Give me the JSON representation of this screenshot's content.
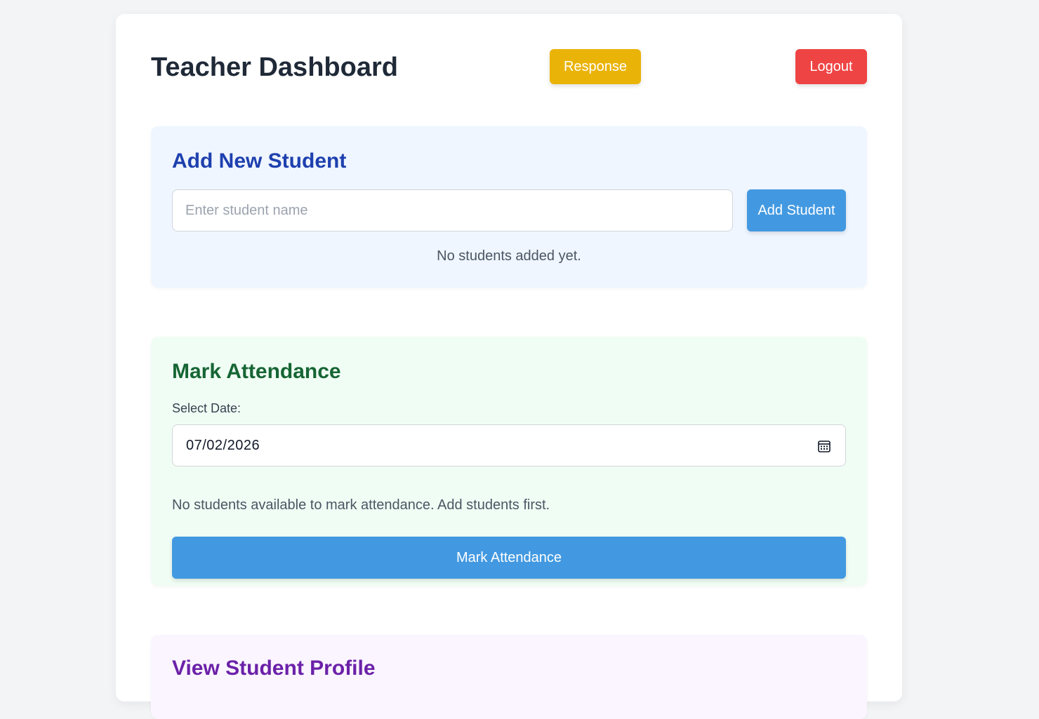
{
  "header": {
    "title": "Teacher Dashboard",
    "response_label": "Response",
    "logout_label": "Logout"
  },
  "add_student": {
    "title": "Add New Student",
    "input_placeholder": "Enter student name",
    "input_value": "",
    "button_label": "Add Student",
    "empty_message": "No students added yet."
  },
  "attendance": {
    "title": "Mark Attendance",
    "date_label": "Select Date:",
    "date_value": "07/02/2026",
    "calendar_icon": "calendar-icon",
    "empty_message": "No students available to mark attendance. Add students first.",
    "button_label": "Mark Attendance"
  },
  "profile": {
    "title": "View Student Profile"
  },
  "colors": {
    "response": "#eab308",
    "logout": "#ef4444",
    "primary": "#4299e1",
    "add_section_bg": "#eff6ff",
    "attendance_section_bg": "#f0fdf4",
    "profile_section_bg": "#faf5ff"
  }
}
